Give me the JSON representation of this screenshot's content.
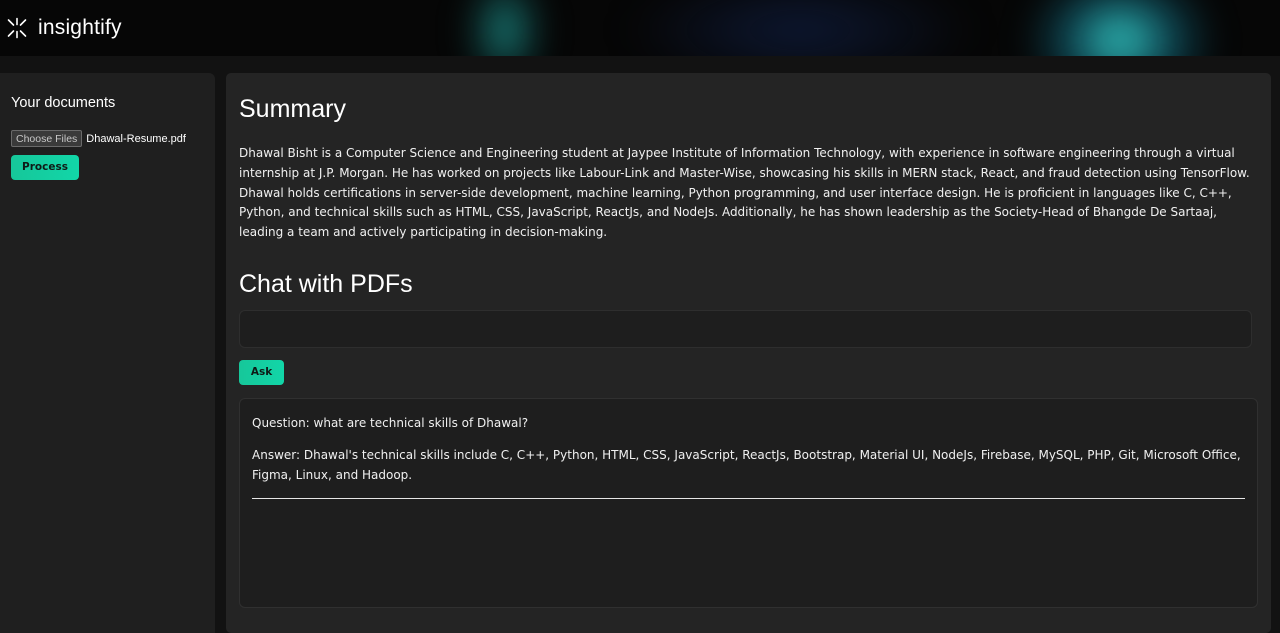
{
  "app": {
    "name": "insightify",
    "logo_icon": "sparkle-asterisk-icon"
  },
  "sidebar": {
    "title": "Your documents",
    "file_button_label": "Choose Files",
    "file_name": "Dhawal-Resume.pdf",
    "process_label": "Process"
  },
  "summary": {
    "title": "Summary",
    "text": "Dhawal Bisht is a Computer Science and Engineering student at Jaypee Institute of Information Technology, with experience in software engineering through a virtual internship at J.P. Morgan. He has worked on projects like Labour-Link and Master-Wise, showcasing his skills in MERN stack, React, and fraud detection using TensorFlow. Dhawal holds certifications in server-side development, machine learning, Python programming, and user interface design. He is proficient in languages like C, C++, Python, and technical skills such as HTML, CSS, JavaScript, ReactJs, and NodeJs. Additionally, he has shown leadership as the Society-Head of Bhangde De Sartaaj, leading a team and actively participating in decision-making."
  },
  "chat": {
    "title": "Chat with PDFs",
    "input_value": "",
    "ask_label": "Ask",
    "question": "Question: what are technical skills of Dhawal?",
    "answer": "Answer: Dhawal's technical skills include C, C++, Python, HTML, CSS, JavaScript, ReactJs, Bootstrap, Material UI, NodeJs, Firebase, MySQL, PHP, Git, Microsoft Office, Figma, Linux, and Hadoop."
  },
  "colors": {
    "accent": "#14cfa0",
    "background": "#121212",
    "panel": "#242424",
    "sidebar": "#1f1f1f"
  }
}
